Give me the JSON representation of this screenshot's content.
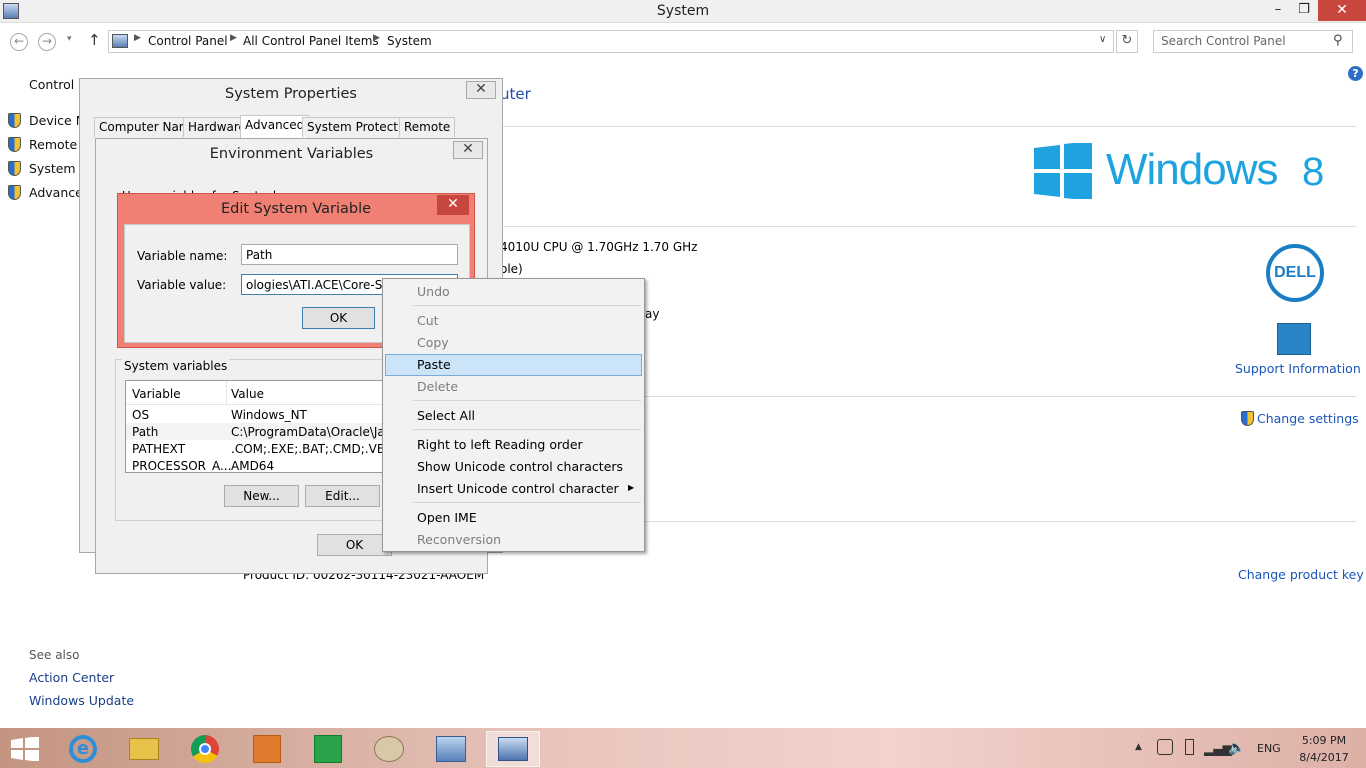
{
  "window": {
    "title": "System"
  },
  "address": {
    "crumbs": [
      "Control Panel",
      "All Control Panel Items",
      "System"
    ],
    "search_placeholder": "Search Control Panel"
  },
  "left_pane": {
    "header": "Control P",
    "links": [
      "Device M",
      "Remote s",
      "System p",
      "Advance"
    ],
    "see_also": "See also",
    "see_also_links": [
      "Action Center",
      "Windows Update"
    ]
  },
  "main": {
    "heading_fragment": "uter",
    "cpu_text": "4010U CPU @ 1.70GHz   1.70 GHz",
    "ram_fragment": "ole)",
    "pen_fragment": "ay",
    "product_id": "Product ID: 00262-30114-23021-AAOEM",
    "windows_logo_text": "Windows",
    "windows_version": "8",
    "support_info": "Support Information",
    "change_settings": "Change settings",
    "change_product_key": "Change product key",
    "dell_text": "DELL"
  },
  "sys_props": {
    "title": "System Properties",
    "tabs": [
      "Computer Name",
      "Hardware",
      "Advanced",
      "System Protection",
      "Remote"
    ],
    "active_tab": "Advanced"
  },
  "env_vars": {
    "title": "Environment Variables",
    "user_vars_label": "User variables for Santosh",
    "sys_vars_label": "System variables",
    "columns": [
      "Variable",
      "Value"
    ],
    "rows": [
      [
        "OS",
        "Windows_NT"
      ],
      [
        "Path",
        "C:\\ProgramData\\Oracle\\Java\\ja"
      ],
      [
        "PATHEXT",
        ".COM;.EXE;.BAT;.CMD;.VBS;.V"
      ],
      [
        "PROCESSOR_A...",
        "AMD64"
      ]
    ],
    "new_label": "New...",
    "edit_label": "Edit...",
    "ok_label": "OK"
  },
  "edit_var": {
    "title": "Edit System Variable",
    "name_label": "Variable name:",
    "name_value": "Path",
    "value_label": "Variable value:",
    "value_value": "ologies\\ATI.ACE\\Core-Static;",
    "ok_label": "OK"
  },
  "context_menu": {
    "items": [
      {
        "label": "Undo",
        "disabled": true
      },
      {
        "label": "Cut",
        "disabled": true
      },
      {
        "label": "Copy",
        "disabled": true
      },
      {
        "label": "Paste",
        "disabled": false
      },
      {
        "label": "Delete",
        "disabled": true
      },
      {
        "label": "Select All",
        "disabled": false
      },
      {
        "label": "Right to left Reading order",
        "disabled": false
      },
      {
        "label": "Show Unicode control characters",
        "disabled": false
      },
      {
        "label": "Insert Unicode control character",
        "disabled": false
      },
      {
        "label": "Open IME",
        "disabled": false
      },
      {
        "label": "Reconversion",
        "disabled": true
      }
    ],
    "highlighted": "Paste"
  },
  "taskbar": {
    "lang": "ENG",
    "time": "5:09 PM",
    "date": "8/4/2017"
  },
  "colors": {
    "accent": "#1a56b8",
    "win_blue": "#1fa3e0",
    "edit_dialog_border": "#f07f74",
    "menu_highlight": "#cce4f7",
    "taskbar": "#e8c4bc"
  }
}
